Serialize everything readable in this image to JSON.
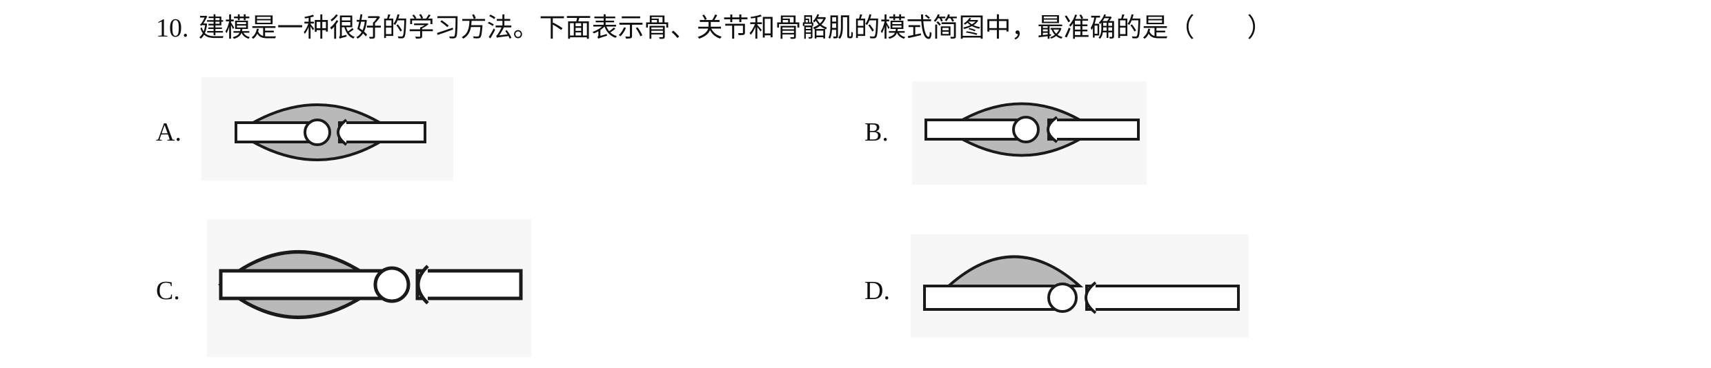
{
  "question": {
    "number": "10.",
    "text": "建模是一种很好的学习方法。下面表示骨、关节和骨骼肌的模式简图中，最准确的是（　　）"
  },
  "options": [
    {
      "label": "A."
    },
    {
      "label": "B."
    },
    {
      "label": "C."
    },
    {
      "label": "D."
    }
  ],
  "colors": {
    "muscle": "#b9b9b9",
    "outline": "#1a1a1a"
  }
}
